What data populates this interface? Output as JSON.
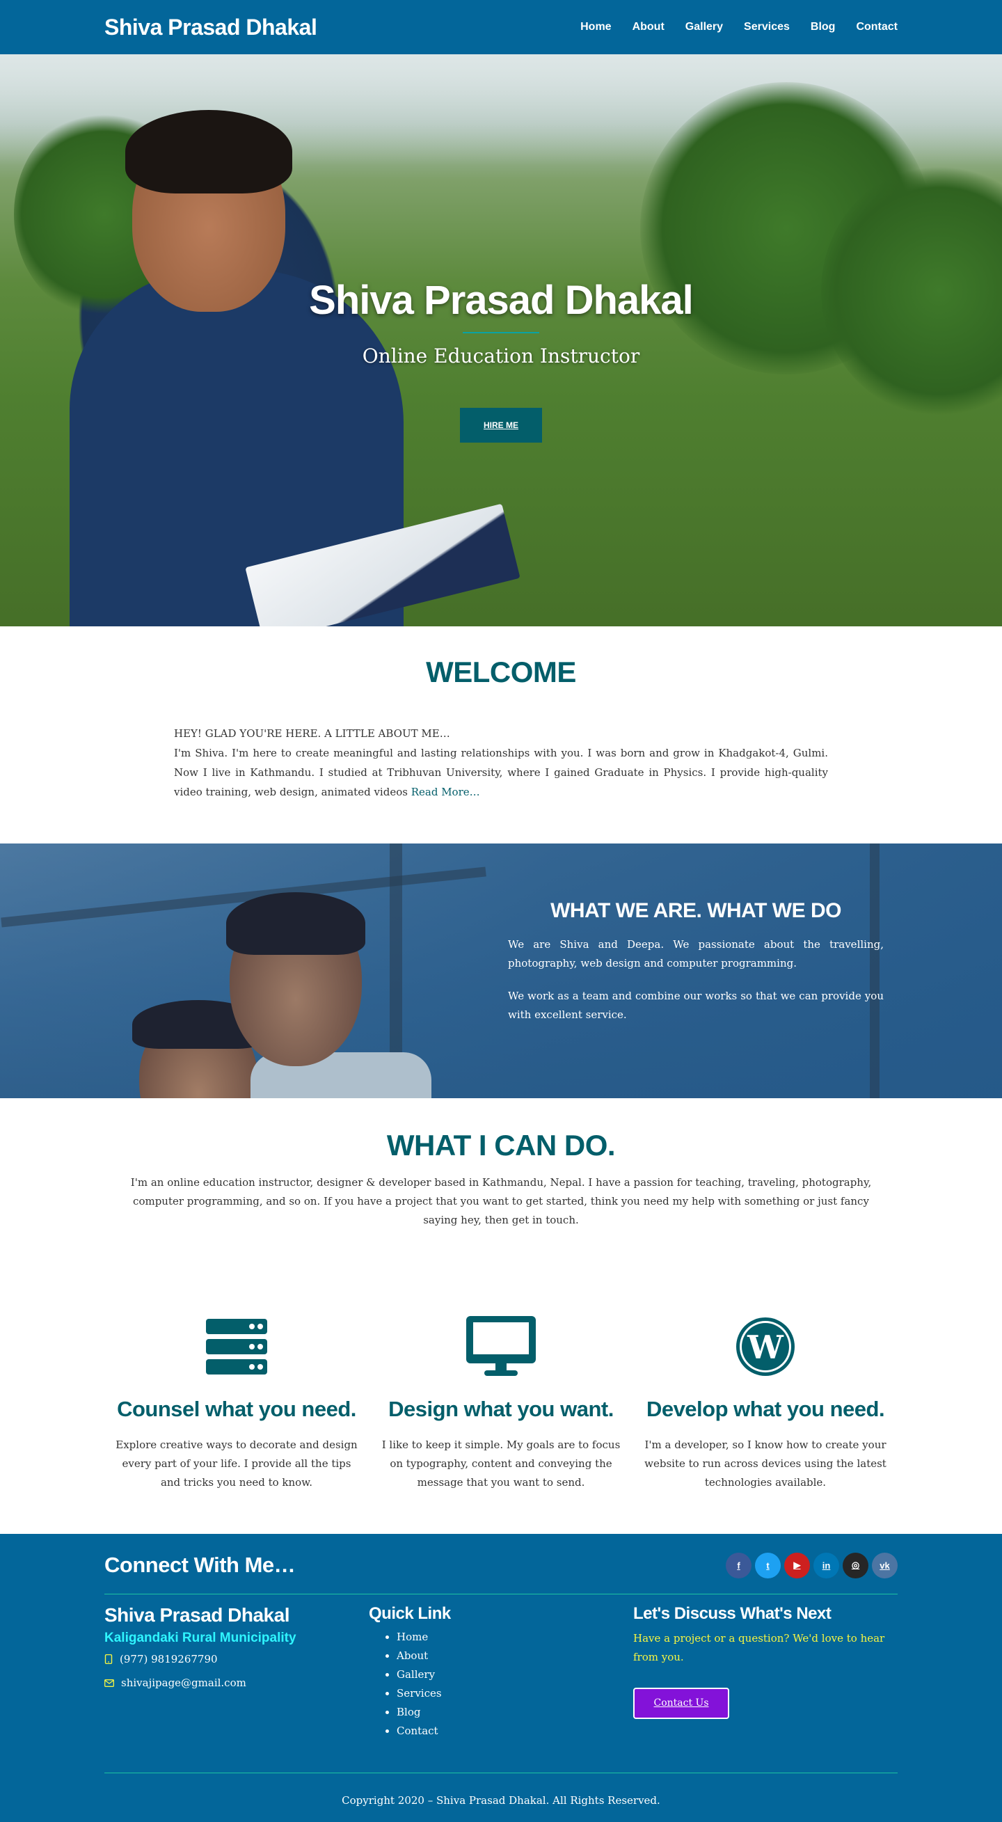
{
  "header": {
    "brand": "Shiva Prasad Dhakal",
    "nav": [
      "Home",
      "About",
      "Gallery",
      "Services",
      "Blog",
      "Contact"
    ]
  },
  "hero": {
    "title": "Shiva Prasad Dhakal",
    "subtitle": "Online Education Instructor",
    "cta": "HIRE ME"
  },
  "welcome": {
    "title": "WELCOME",
    "lead": "HEY! GLAD YOU'RE HERE. A LITTLE ABOUT ME…",
    "body": "I'm Shiva. I'm here to create meaningful and lasting relationships with you. I was born and grow in Khadgakot-4, Gulmi. Now I live in Kathmandu. I studied at Tribhuvan University, where I gained Graduate in Physics. I provide high-quality video training, web design, animated videos",
    "read_more": "Read More…"
  },
  "about": {
    "heading": "WHAT WE ARE. WHAT WE DO",
    "p1": "We are Shiva and Deepa. We passionate about the travelling, photography, web design and computer programming.",
    "p2": "We work as a team and combine our works so that we can provide you with excellent service."
  },
  "services": {
    "title": "WHAT I CAN DO.",
    "intro": "I'm an online education instructor, designer & developer based in Kathmandu, Nepal. I have a passion for teaching, traveling, photography, computer programming, and so on. If you have a project that you want to get started, think you need my help with something or just fancy saying hey, then get in touch.",
    "items": [
      {
        "icon": "server-icon",
        "title": "Counsel what you need.",
        "text": "Explore creative ways to decorate and design every part of your life. I provide all the tips and tricks you need to know."
      },
      {
        "icon": "monitor-icon",
        "title": "Design what you want.",
        "text": "I like to keep it simple. My goals are to focus on typography, content and conveying the message that you want to send."
      },
      {
        "icon": "wordpress-icon",
        "title": "Develop what you need.",
        "text": "I'm a developer, so I know how to create your website to run across devices using the latest technologies available."
      }
    ]
  },
  "footer": {
    "connect": "Connect With Me…",
    "socials": [
      {
        "icon": "facebook-icon",
        "glyph": "f",
        "color": "#3b5998"
      },
      {
        "icon": "twitter-icon",
        "glyph": "t",
        "color": "#1da1f2"
      },
      {
        "icon": "youtube-icon",
        "glyph": "▶",
        "color": "#cd201f"
      },
      {
        "icon": "linkedin-icon",
        "glyph": "in",
        "color": "#0077b5"
      },
      {
        "icon": "instagram-icon",
        "glyph": "◎",
        "color": "#262626"
      },
      {
        "icon": "vk-icon",
        "glyph": "vk",
        "color": "#4c75a3"
      }
    ],
    "name": "Shiva Prasad Dhakal",
    "municipality": "Kaligandaki Rural Municipality",
    "phone": "(977) 9819267790",
    "email": "shivajipage@gmail.com",
    "quick_title": "Quick Link",
    "quick_links": [
      "Home",
      "About",
      "Gallery",
      "Services",
      "Blog",
      "Contact"
    ],
    "discuss_title": "Let's Discuss What's Next",
    "discuss_text": "Have a project or a question? We'd love to hear from you.",
    "contact_btn": "Contact Us",
    "copyright": "Copyright 2020 – Shiva Prasad Dhakal. All Rights Reserved.",
    "colors": {
      "accent_line": "#1cc3a0",
      "municipality": "#2ff5ff",
      "discuss_text": "#f5f542",
      "button": "#8312d9"
    }
  },
  "colors": {
    "header_bg": "#03669a",
    "primary_teal": "#035e6a"
  }
}
